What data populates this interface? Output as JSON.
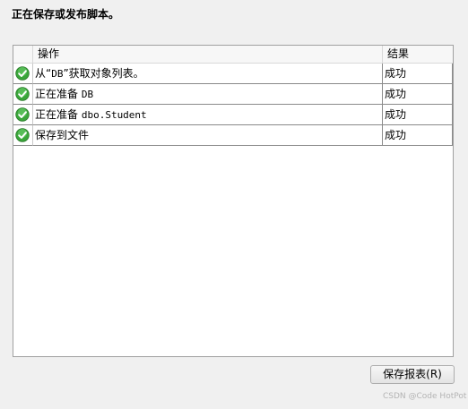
{
  "heading": "正在保存或发布脚本。",
  "table": {
    "columns": [
      "",
      "操作",
      "结果"
    ],
    "rows": [
      {
        "status_icon": "success-check-icon",
        "op_pre": "从“",
        "op_code": "DB",
        "op_post": "”获取对象列表。",
        "result": "成功"
      },
      {
        "status_icon": "success-check-icon",
        "op_pre": "正在准备 ",
        "op_code": "DB",
        "op_post": "",
        "result": "成功"
      },
      {
        "status_icon": "success-check-icon",
        "op_pre": "正在准备 ",
        "op_code": "dbo.Student",
        "op_post": "",
        "result": "成功"
      },
      {
        "status_icon": "success-check-icon",
        "op_pre": "保存到文件",
        "op_code": "",
        "op_post": "",
        "result": "成功"
      }
    ]
  },
  "buttons": {
    "save_report": "保存报表(R)"
  },
  "watermark": "CSDN @Code HotPot",
  "colors": {
    "success_green": "#3aa63a",
    "window_bg": "#f0f0f0"
  }
}
